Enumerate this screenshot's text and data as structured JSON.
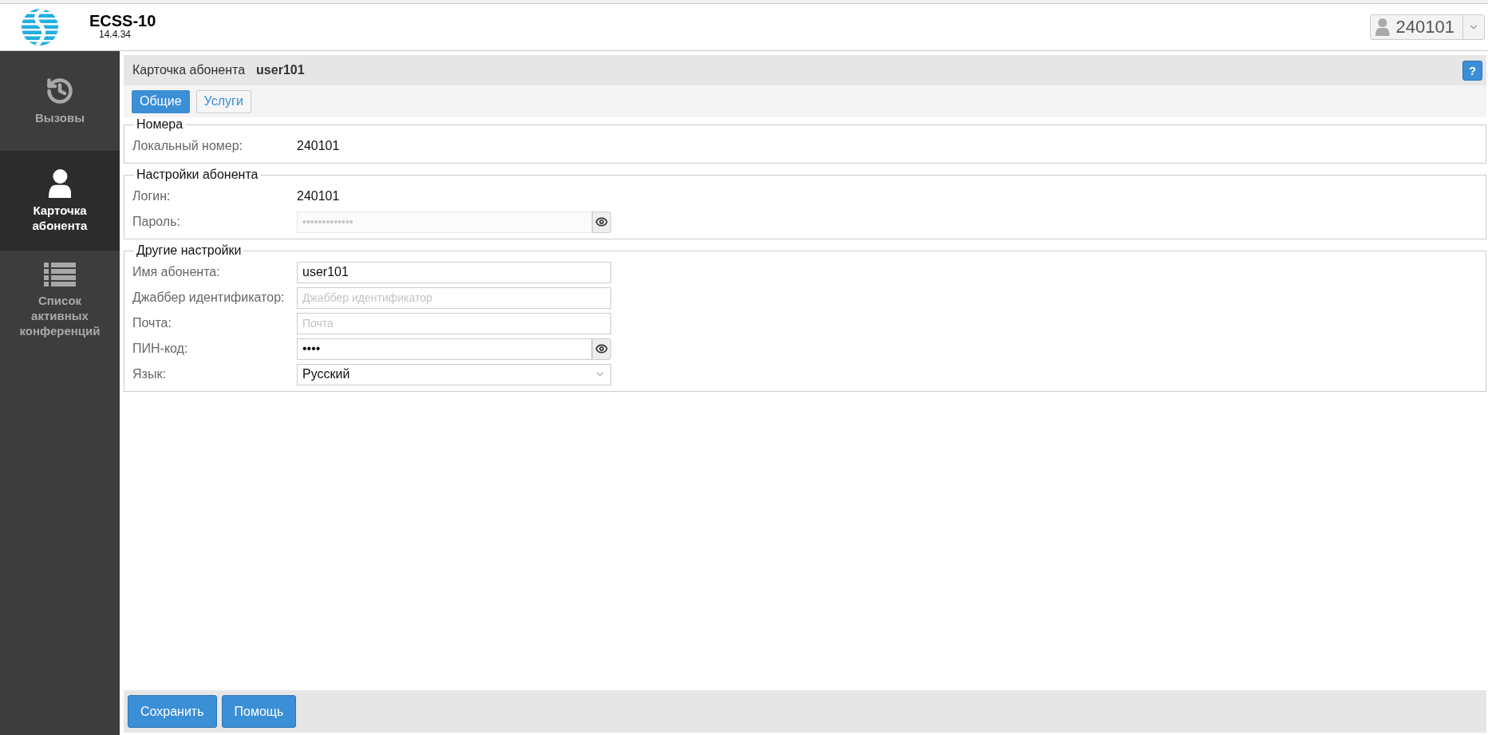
{
  "header": {
    "product": "ECSS-10",
    "version": "14.4.34",
    "user": "240101"
  },
  "sidebar": {
    "items": [
      {
        "label": "Вызовы",
        "kind": "history",
        "selected": false
      },
      {
        "label": "Карточка абонента",
        "kind": "user",
        "selected": true
      },
      {
        "label": "Список активных конференций",
        "kind": "list",
        "selected": false
      }
    ]
  },
  "card": {
    "title": "Карточка абонента",
    "subscriber": "user101",
    "help": "?"
  },
  "tabs": [
    {
      "label": "Общие",
      "selected": true
    },
    {
      "label": "Услуги",
      "selected": false
    }
  ],
  "sections": [
    {
      "legend": "Номера",
      "rows": [
        {
          "kind": "text",
          "label": "Локальный номер:",
          "value": "240101"
        }
      ]
    },
    {
      "legend": "Настройки абонента",
      "rows": [
        {
          "kind": "text",
          "label": "Логин:",
          "value": "240101"
        },
        {
          "kind": "secret",
          "label": "Пароль:",
          "placeholder": "•••••••••••••",
          "disabled": true
        }
      ]
    },
    {
      "legend": "Другие настройки",
      "rows": [
        {
          "kind": "input",
          "label": "Имя абонента:",
          "value": "user101"
        },
        {
          "kind": "input",
          "label": "Джаббер идентификатор:",
          "placeholder": "Джаббер идентификатор"
        },
        {
          "kind": "input",
          "label": "Почта:",
          "placeholder": "Почта"
        },
        {
          "kind": "secret",
          "label": "ПИН-код:",
          "value": "••••",
          "disabled": false
        },
        {
          "kind": "select",
          "label": "Язык:",
          "value": "Русский"
        }
      ]
    }
  ],
  "footer": {
    "buttons": [
      "Сохранить",
      "Помощь"
    ]
  }
}
